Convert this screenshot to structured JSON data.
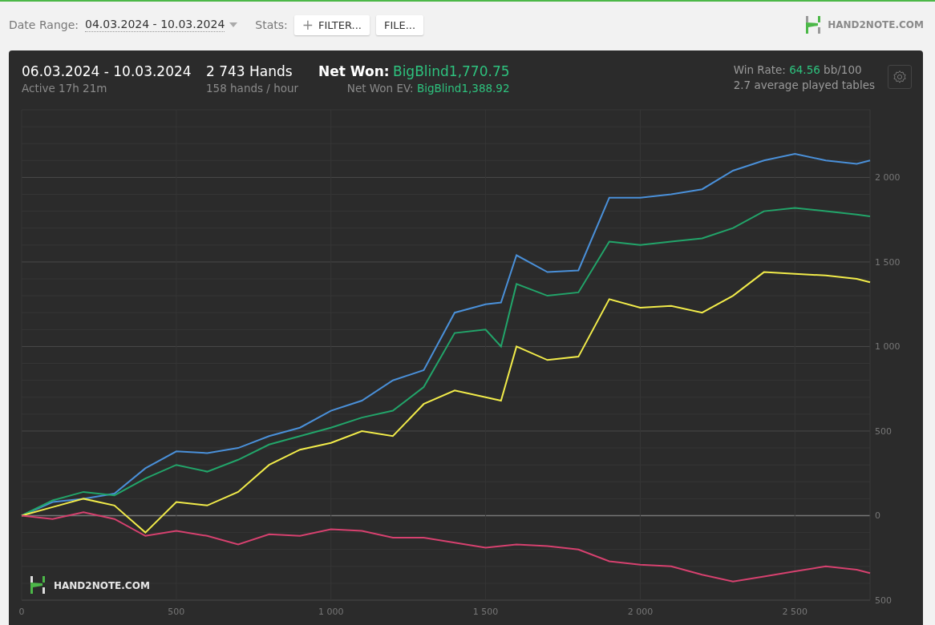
{
  "toolbar": {
    "date_range_label": "Date Range:",
    "date_range_value": "04.03.2024 - 10.03.2024",
    "stats_label": "Stats:",
    "buttons": [
      {
        "kind": "filter",
        "icon": "+",
        "label": "FILTER..."
      },
      {
        "kind": "file",
        "label": "FILE..."
      }
    ],
    "logo": "HAND2NOTE.COM"
  },
  "summary": {
    "period": "06.03.2024 - 10.03.2024",
    "active": "Active 17h 21m",
    "hands": "2 743 Hands",
    "hands_per_hour": "158 hands / hour",
    "net_won_label": "Net Won:",
    "net_won_value": "BigBlind1,770.75",
    "ev_label": "Net Won  EV:",
    "ev_value": "BigBlind1,388.92",
    "win_rate_label": "Win Rate:",
    "win_rate_value": "64.56",
    "win_rate_unit": "bb/100",
    "tables": "2.7 average played tables"
  },
  "chart_logo": "HAND2NOTE.COM",
  "chart_data": {
    "type": "line",
    "grid": true,
    "x": [
      0,
      100,
      200,
      300,
      400,
      500,
      600,
      700,
      800,
      900,
      1000,
      1100,
      1200,
      1300,
      1400,
      1500,
      1550,
      1600,
      1700,
      1800,
      1900,
      2000,
      2100,
      2200,
      2300,
      2400,
      2500,
      2600,
      2700,
      2743
    ],
    "series": [
      {
        "color": "#4a90d9",
        "values": [
          0,
          80,
          100,
          130,
          280,
          380,
          370,
          400,
          470,
          520,
          620,
          680,
          800,
          860,
          1200,
          1250,
          1260,
          1540,
          1440,
          1450,
          1880,
          1880,
          1900,
          1930,
          2040,
          2100,
          2140,
          2100,
          2080,
          2100
        ]
      },
      {
        "color": "#22a56a",
        "values": [
          0,
          90,
          140,
          120,
          220,
          300,
          260,
          330,
          420,
          470,
          520,
          580,
          620,
          760,
          1080,
          1100,
          1000,
          1370,
          1300,
          1320,
          1620,
          1600,
          1620,
          1640,
          1700,
          1800,
          1820,
          1800,
          1780,
          1770
        ]
      },
      {
        "color": "#f2ec4a",
        "values": [
          0,
          50,
          100,
          60,
          -100,
          80,
          60,
          140,
          300,
          390,
          430,
          500,
          470,
          660,
          740,
          700,
          680,
          1000,
          920,
          940,
          1280,
          1230,
          1240,
          1200,
          1300,
          1440,
          1430,
          1420,
          1400,
          1380
        ]
      },
      {
        "color": "#d6416f",
        "values": [
          0,
          -20,
          20,
          -20,
          -120,
          -90,
          -120,
          -170,
          -110,
          -120,
          -80,
          -90,
          -130,
          -130,
          -160,
          -190,
          -180,
          -170,
          -180,
          -200,
          -270,
          -290,
          -300,
          -350,
          -390,
          -360,
          -330,
          -300,
          -320,
          -340
        ]
      }
    ],
    "xlim": [
      0,
      2743
    ],
    "ylim": [
      -500,
      2400
    ],
    "xticks": [
      {
        "value": 0,
        "label": "0"
      },
      {
        "value": 500,
        "label": "500"
      },
      {
        "value": 1000,
        "label": "1 000"
      },
      {
        "value": 1500,
        "label": "1 500"
      },
      {
        "value": 2000,
        "label": "2 000"
      },
      {
        "value": 2500,
        "label": "2 500"
      }
    ],
    "yticks": [
      {
        "value": 2000,
        "label": "2 000"
      },
      {
        "value": 1500,
        "label": "1 500"
      },
      {
        "value": 1000,
        "label": "1 000"
      },
      {
        "value": 500,
        "label": "500"
      },
      {
        "value": 0,
        "label": "0"
      },
      {
        "value": -500,
        "label": "500"
      }
    ]
  }
}
